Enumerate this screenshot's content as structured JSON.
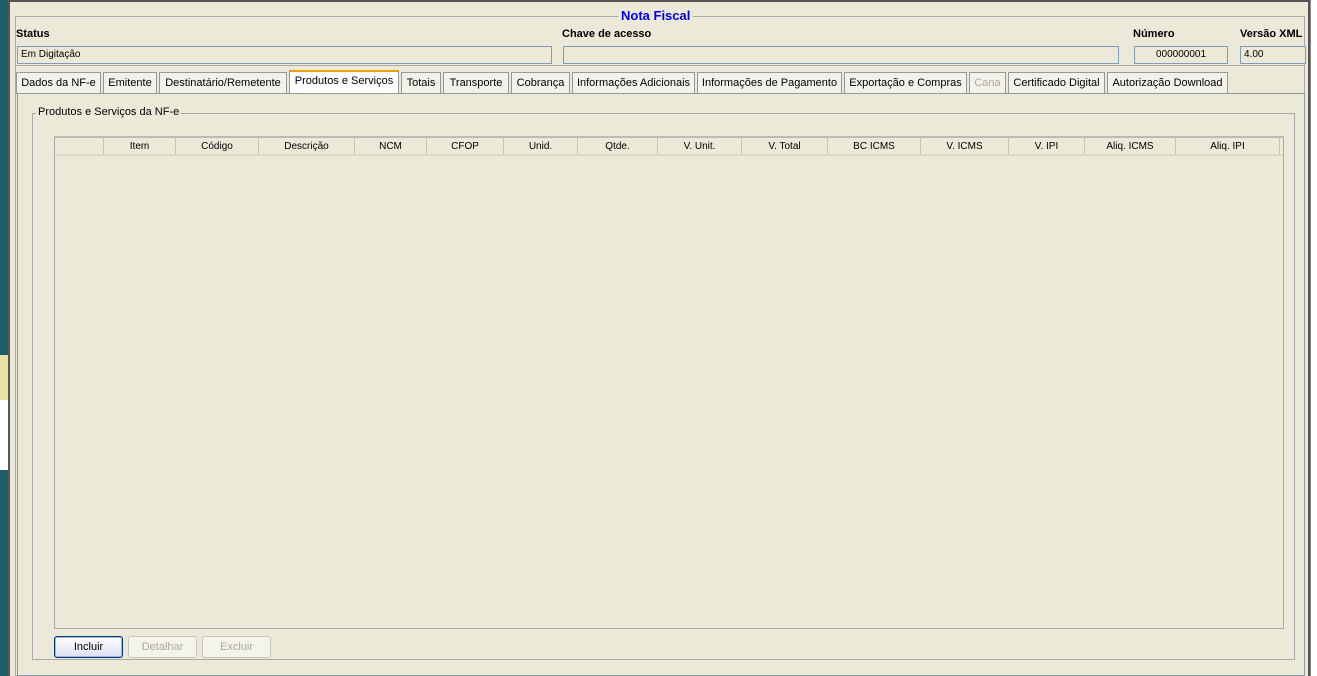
{
  "window": {
    "title": "Nota Fiscal"
  },
  "header": {
    "status_label": "Status",
    "status_value": "Em Digitação",
    "chave_label": "Chave de acesso",
    "chave_value": "",
    "numero_label": "Número",
    "numero_value": "000000001",
    "versao_label": "Versão XML",
    "versao_value": "4.00"
  },
  "tabs": [
    {
      "label": "Dados da NF-e"
    },
    {
      "label": "Emitente"
    },
    {
      "label": "Destinatário/Remetente"
    },
    {
      "label": "Produtos e Serviços",
      "active": true
    },
    {
      "label": "Totais"
    },
    {
      "label": "Transporte"
    },
    {
      "label": "Cobrança"
    },
    {
      "label": "Informações Adicionais"
    },
    {
      "label": "Informações de Pagamento"
    },
    {
      "label": "Exportação e Compras"
    },
    {
      "label": "Cana",
      "disabled": true
    },
    {
      "label": "Certificado Digital"
    },
    {
      "label": "Autorização Download"
    }
  ],
  "group": {
    "title": "Produtos e Serviços da NF-e"
  },
  "table": {
    "columns": [
      "",
      "Item",
      "Código",
      "Descrição",
      "NCM",
      "CFOP",
      "Unid.",
      "Qtde.",
      "V. Unit.",
      "V. Total",
      "BC ICMS",
      "V. ICMS",
      "V. IPI",
      "Aliq. ICMS",
      "Aliq. IPI"
    ],
    "rows": []
  },
  "buttons": {
    "incluir": "Incluir",
    "detalhar": "Detalhar",
    "excluir": "Excluir"
  }
}
